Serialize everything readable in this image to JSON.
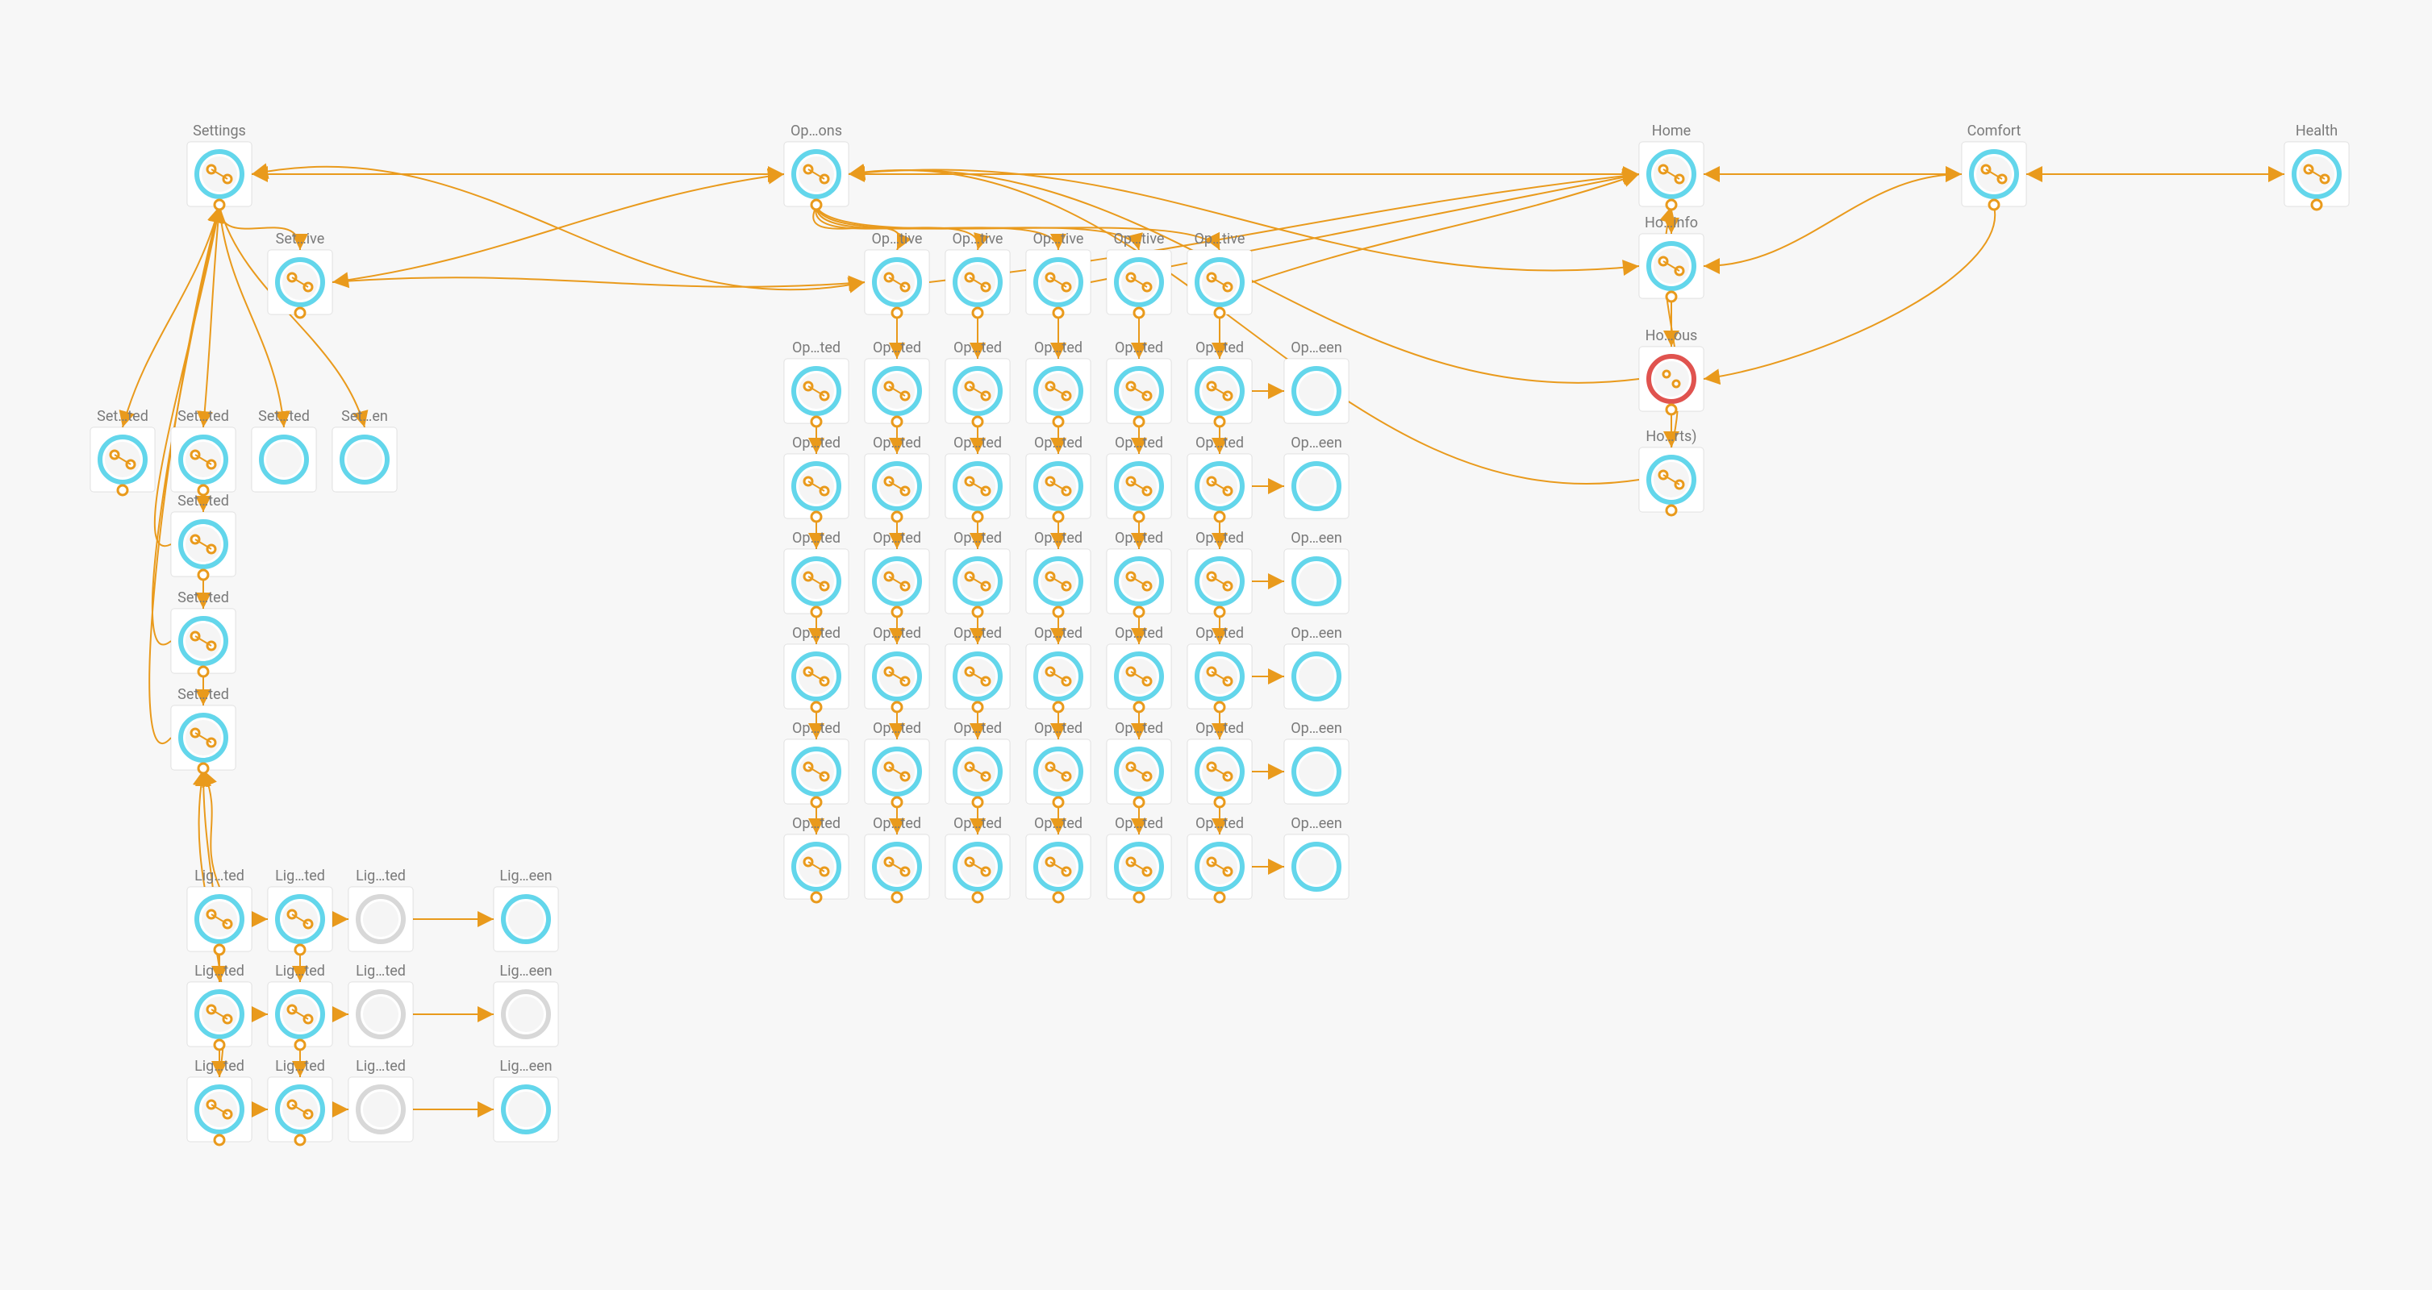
{
  "colors": {
    "bg": "#f7f7f7",
    "node_text": "#7a7a7a",
    "ring_cyan": "#63d6eb",
    "ring_red": "#e0534f",
    "ring_grey": "#d8d8d8",
    "edge": "#e99a1c"
  },
  "labels": {
    "settings": "Settings",
    "options": "Op…ons",
    "home": "Home",
    "comfort": "Comfort",
    "health": "Health",
    "set_ive": "Set…ive",
    "set_ted": "Set…ted",
    "set_een": "Set…en",
    "op_tive": "Op…tive",
    "op_ted": "Op…ted",
    "op_een": "Op…een",
    "ho_info": "Ho…info",
    "ho_ous": "Ho…ous",
    "ho_rts": "Ho…rts)",
    "lig_ted": "Lig…ted",
    "lig_een": "Lig…een"
  }
}
